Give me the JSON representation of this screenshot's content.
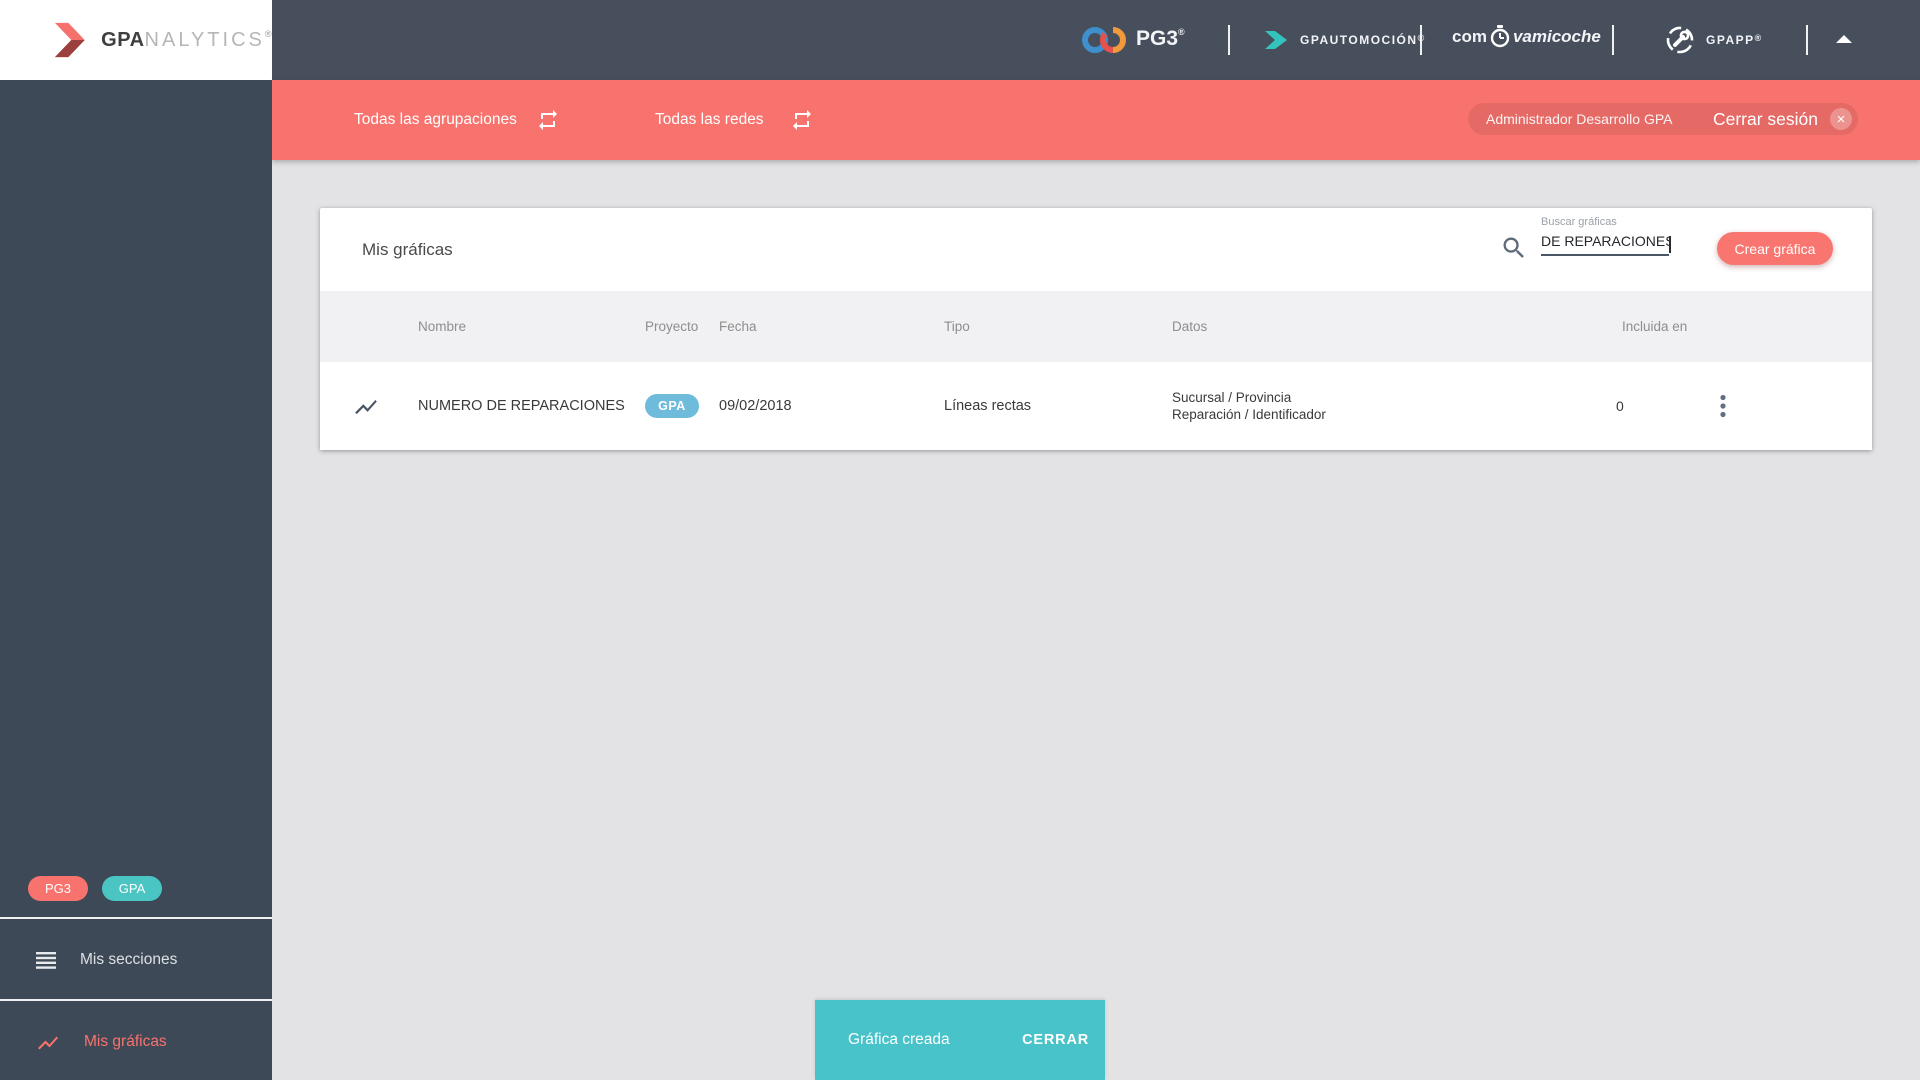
{
  "misc": {
    "registered": "®"
  },
  "logo": {
    "bold": "GPA",
    "light": "NALYTICS"
  },
  "topbar": {
    "pg3": "PG3",
    "gpautomocion": "GPAUTOMOCIÓN",
    "comprova_prefix": "com",
    "comprova_suffix": "vamicoche",
    "gpapp": "GPAPP"
  },
  "filterbar": {
    "agrupaciones": "Todas las agrupaciones",
    "redes": "Todas las redes",
    "user": "Administrador Desarrollo GPA",
    "logout": "Cerrar sesión",
    "logout_icon": "×"
  },
  "sidebar": {
    "badge_pg3": "PG3",
    "badge_gpa": "GPA",
    "item_secciones": "Mis secciones",
    "item_graficas": "Mis gráficas"
  },
  "card": {
    "title": "Mis gráficas",
    "search": {
      "label": "Buscar gráficas",
      "value": "DE REPARACIONES"
    },
    "create_button": "Crear gráfica",
    "table": {
      "headers": [
        "Nombre",
        "Proyecto",
        "Fecha",
        "Tipo",
        "Datos",
        "Incluida en"
      ],
      "rows": [
        {
          "nombre": "NUMERO DE REPARACIONES",
          "proyecto": "GPA",
          "fecha": "09/02/2018",
          "tipo": "Líneas rectas",
          "datos_line1": "Sucursal / Provincia",
          "datos_line2": "Reparación / Identificador",
          "incluida_en": "0"
        }
      ]
    }
  },
  "snackbar": {
    "message": "Gráfica creada",
    "action": "CERRAR"
  },
  "colors": {
    "accent_red": "#F8736E",
    "teal": "#47C3C9",
    "sidebar_teal_badge": "#4BC5C4",
    "project_badge_blue": "#6FBBDB",
    "topbar_slate": "#474F5D",
    "sidebar_slate": "#3D4956",
    "page_bg": "#E3E3E5"
  }
}
